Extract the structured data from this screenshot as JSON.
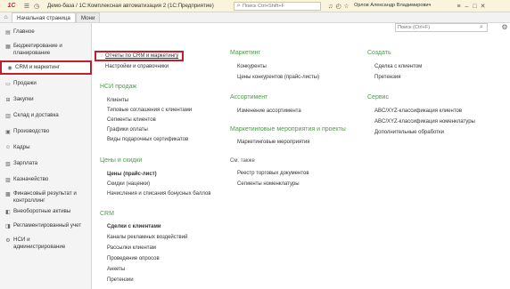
{
  "titlebar": {
    "logo": "1С",
    "title": "Демо-база / 1С:Комплексная автоматизация 2  (1С:Предприятие)",
    "search_placeholder": "Поиск Ctrl+Shift+F",
    "user": "Орлов Александр Владимирович"
  },
  "tabs": {
    "home": "Начальная страница",
    "second": "Мони"
  },
  "sidebar": {
    "items": [
      {
        "icon": "home",
        "label": "Главное"
      },
      {
        "icon": "budget",
        "label": "Бюджетирование и планирование"
      },
      {
        "icon": "crm",
        "label": "CRM и маркетинг"
      },
      {
        "icon": "sales",
        "label": "Продажи"
      },
      {
        "icon": "purchases",
        "label": "Закупки"
      },
      {
        "icon": "warehouse",
        "label": "Склад и доставка"
      },
      {
        "icon": "production",
        "label": "Производство"
      },
      {
        "icon": "hr",
        "label": "Кадры"
      },
      {
        "icon": "salary",
        "label": "Зарплата"
      },
      {
        "icon": "treasury",
        "label": "Казначейство"
      },
      {
        "icon": "finance",
        "label": "Финансовый результат и контроллинг"
      },
      {
        "icon": "assets",
        "label": "Внеоборотные активы"
      },
      {
        "icon": "accounting",
        "label": "Регламентированный учет"
      },
      {
        "icon": "admin",
        "label": "НСИ и администрирование"
      }
    ]
  },
  "content": {
    "search_placeholder": "Поиск (Ctrl+F)",
    "col1": {
      "top_links": [
        "Отчеты по CRM и маркетингу",
        "Настройки и справочники"
      ],
      "nsi_title": "НСИ продаж",
      "nsi_links": [
        "Клиенты",
        "Типовые соглашения с клиентами",
        "Сегменты клиентов",
        "Графики оплаты",
        "Виды подарочных сертификатов"
      ],
      "prices_title": "Цены и скидки",
      "prices_links": [
        "Цены (прайс-лист)",
        "Скидки (наценки)",
        "Начисления и списания бонусных баллов"
      ],
      "crm_title": "CRM",
      "crm_links": [
        "Сделки с клиентами",
        "Каналы рекламных воздействий",
        "Рассылки клиентам",
        "Проведение опросов",
        "Анкеты",
        "Претензии"
      ]
    },
    "col2": {
      "marketing_title": "Маркетинг",
      "marketing_links": [
        "Конкуренты",
        "Цены конкурентов (прайс-листы)"
      ],
      "assortment_title": "Ассортимент",
      "assortment_links": [
        "Изменение ассортимента"
      ],
      "events_title": "Маркетинговые мероприятия и проекты",
      "events_links": [
        "Маркетинговые мероприятия"
      ],
      "see_also": "См. также",
      "see_also_links": [
        "Реестр торговых документов",
        "Сегменты номенклатуры"
      ]
    },
    "col3": {
      "create_title": "Создать",
      "create_links": [
        "Сделка с клиентом",
        "Претензия"
      ],
      "service_title": "Сервис",
      "service_links": [
        "ABC/XYZ-классификация клиентов",
        "ABC/XYZ-классификация номенклатуры",
        "Дополнительные обработки"
      ]
    }
  },
  "colors": {
    "section_title": "#4f9a4b",
    "highlight": "#c0202c",
    "titlebar_bg": "#fbf4dd"
  }
}
